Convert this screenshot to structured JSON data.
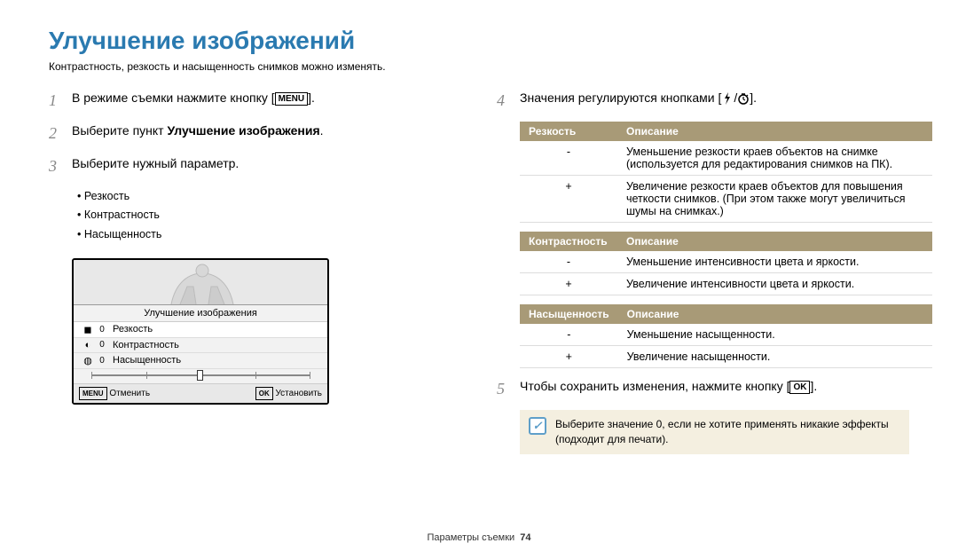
{
  "heading": "Улучшение изображений",
  "subtitle": "Контрастность, резкость и насыщенность снимков можно изменять.",
  "steps": {
    "s1_pre": "В режиме съемки нажмите кнопку [",
    "s1_post": "].",
    "s2_pre": "Выберите пункт ",
    "s2_bold": "Улучшение изображения",
    "s2_post": ".",
    "s3": "Выберите нужный параметр.",
    "s4_pre": "Значения регулируются кнопками [",
    "s4_mid": "/",
    "s4_post": "].",
    "s5_pre": "Чтобы сохранить изменения, нажмите кнопку [",
    "s5_post": "]."
  },
  "bullets": [
    "Резкость",
    "Контрастность",
    "Насыщенность"
  ],
  "lcd": {
    "title": "Улучшение изображения",
    "rows": [
      {
        "val": "0",
        "label": "Резкость"
      },
      {
        "val": "0",
        "label": "Контрастность"
      },
      {
        "val": "0",
        "label": "Насыщенность"
      }
    ],
    "cancel": "Отменить",
    "set": "Установить"
  },
  "tables": [
    {
      "h1": "Резкость",
      "h2": "Описание",
      "rows": [
        {
          "k": "-",
          "v": "Уменьшение резкости краев объектов на снимке (используется для редактирования снимков на ПК)."
        },
        {
          "k": "+",
          "v": "Увеличение резкости краев объектов для повышения четкости снимков. (При этом также могут увеличиться шумы на снимках.)"
        }
      ]
    },
    {
      "h1": "Контрастность",
      "h2": "Описание",
      "rows": [
        {
          "k": "-",
          "v": "Уменьшение интенсивности цвета и яркости."
        },
        {
          "k": "+",
          "v": "Увеличение интенсивности цвета и яркости."
        }
      ]
    },
    {
      "h1": "Насыщенность",
      "h2": "Описание",
      "rows": [
        {
          "k": "-",
          "v": "Уменьшение насыщенности."
        },
        {
          "k": "+",
          "v": "Увеличение насыщенности."
        }
      ]
    }
  ],
  "note": "Выберите значение 0, если не хотите применять никакие эффекты (подходит для печати).",
  "footer_label": "Параметры съемки",
  "footer_page": "74",
  "icons": {
    "menu": "MENU",
    "ok": "OK"
  }
}
